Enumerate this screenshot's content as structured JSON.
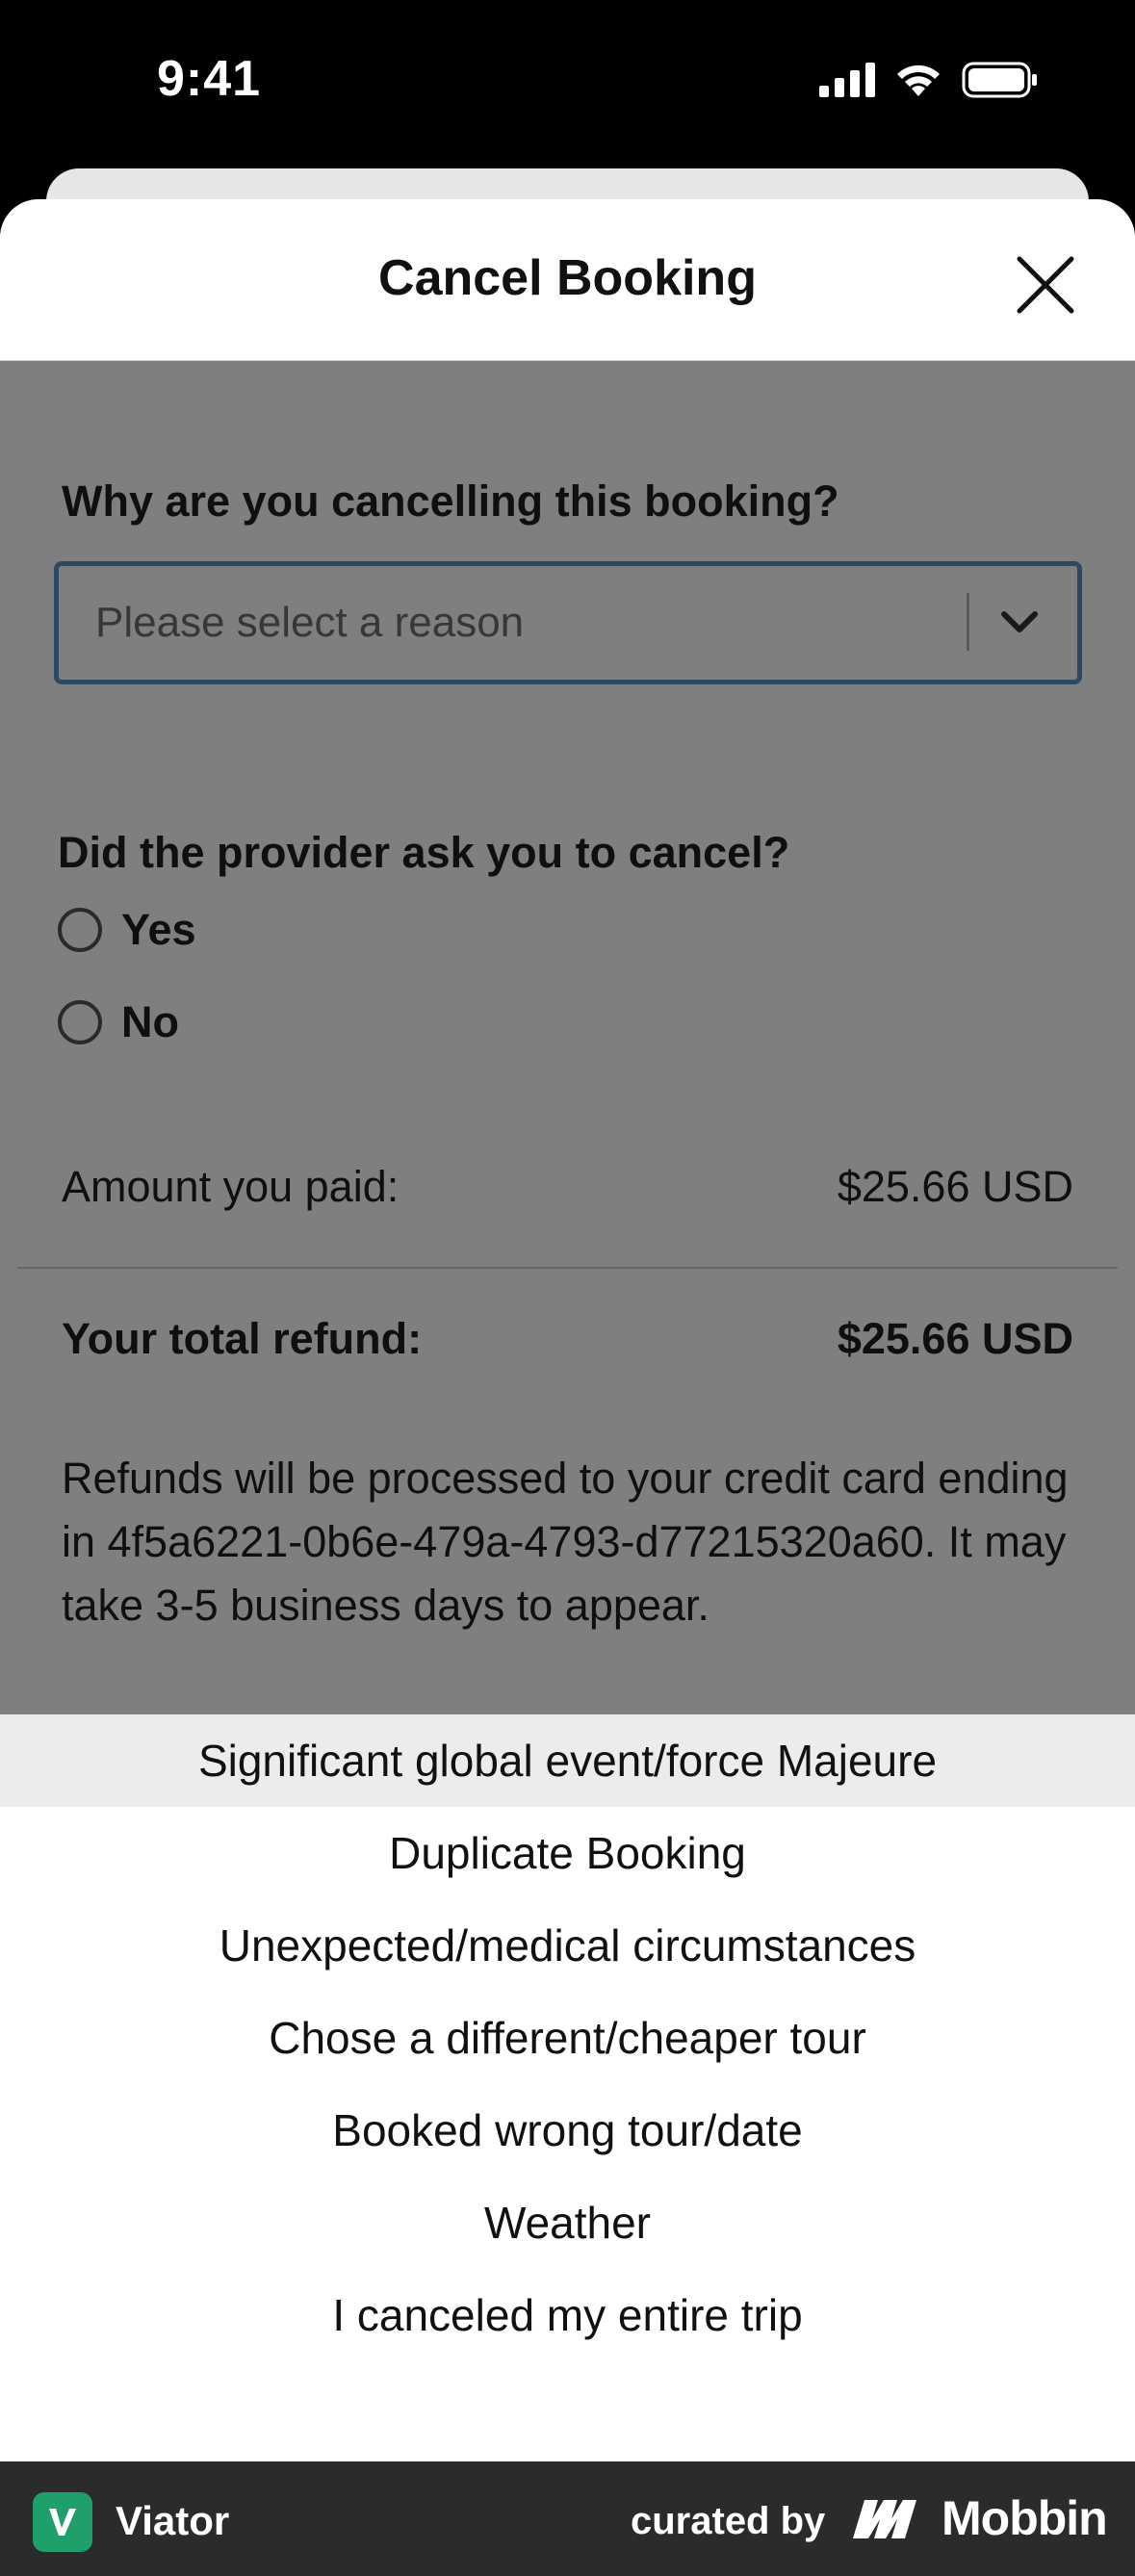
{
  "status_bar": {
    "time": "9:41"
  },
  "modal": {
    "title": "Cancel Booking",
    "reason_question": "Why are you cancelling this booking?",
    "reason_placeholder": "Please select a reason",
    "provider_question": "Did the provider ask you to cancel?",
    "radio_options": [
      "Yes",
      "No"
    ],
    "amount_paid_label": "Amount you paid:",
    "amount_paid_value": "$25.66 USD",
    "total_refund_label": "Your total refund:",
    "total_refund_value": "$25.66 USD",
    "refund_note": "Refunds will be processed to your credit card ending in 4f5a6221-0b6e-479a-4793-d77215320a60. It may take 3-5 business days to appear."
  },
  "picker": {
    "options": [
      "Significant global event/force Majeure",
      "Duplicate Booking",
      "Unexpected/medical circumstances",
      "Chose a different/cheaper tour",
      "Booked wrong tour/date",
      "Weather",
      "I canceled my entire trip"
    ],
    "selected_index": 0
  },
  "footer": {
    "app_name": "Viator",
    "curated_by": "curated by",
    "brand": "Mobbin"
  },
  "colors": {
    "overlay": "#000000",
    "select_border": "#5b8fc9",
    "footer_bg": "#2b2b2b",
    "app_icon": "#1f9f6a"
  },
  "icons": [
    "signal-icon",
    "wifi-icon",
    "battery-icon",
    "close-icon",
    "chevron-down-icon",
    "viator-logo-icon",
    "mobbin-logo-icon"
  ]
}
